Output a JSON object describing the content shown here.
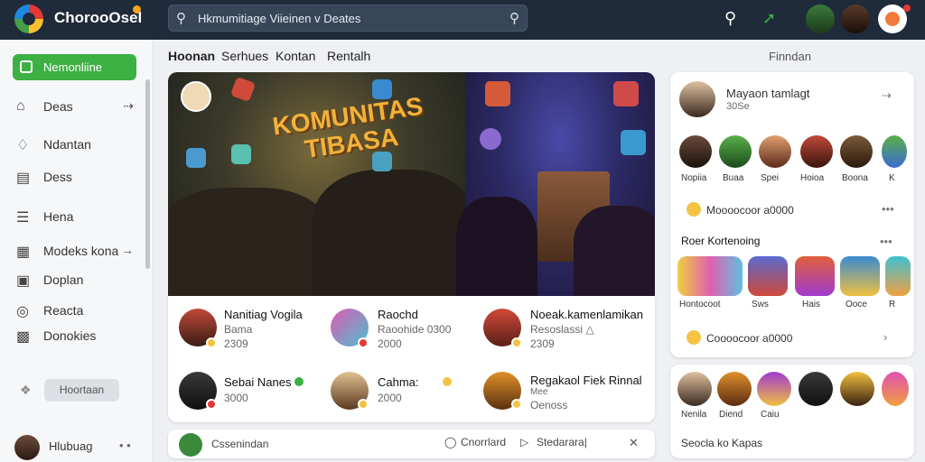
{
  "app": {
    "title": "ChorooOsel"
  },
  "search": {
    "query": "Hkmumitiage Viieinen v Deates"
  },
  "sidebar": {
    "active": "Nemonliine",
    "items": [
      {
        "label": "Deas",
        "icon": "home-icon",
        "arrow": "⇢"
      },
      {
        "label": "Ndantan",
        "icon": "bell-icon",
        "arrow": ""
      },
      {
        "label": "Dess",
        "icon": "window-icon",
        "arrow": ""
      },
      {
        "label": "Hena",
        "icon": "list-icon",
        "arrow": ""
      },
      {
        "label": "Modeks kona",
        "icon": "grid-icon",
        "arrow": "→"
      },
      {
        "label": "Doplan",
        "icon": "calendar-icon",
        "arrow": ""
      },
      {
        "label": "Reacta",
        "icon": "pin-icon",
        "arrow": ""
      },
      {
        "label": "Donokies",
        "icon": "chart-icon",
        "arrow": ""
      }
    ],
    "button": "Hoortaan",
    "user": {
      "name": "Hlubuag",
      "more": "• •"
    }
  },
  "tabs": [
    "Hoonan",
    "Serhues",
    "Kontan",
    "Rentalh"
  ],
  "filter_label": "Finndan",
  "hero": {
    "title": "KOMUNITAS TIBASA"
  },
  "cards": [
    {
      "name": "Nanitiag Vogila",
      "sub1": "Bama",
      "sub2": "2309"
    },
    {
      "name": "Raochd",
      "sub1": "Raoohide 0300",
      "sub2": "2000"
    },
    {
      "name": "Noeak.kamenlamikan",
      "sub1": "Resoslassi △",
      "sub2": "2309"
    },
    {
      "name": "Sebai Nanes",
      "sub1": "3000",
      "sub2": ""
    },
    {
      "name": "Cahma:",
      "sub1": "2000",
      "sub2": ""
    },
    {
      "name": "Regakaol Fiek Rinnal",
      "sub1": "Mee",
      "sub2": "Oenoss"
    }
  ],
  "bottom": {
    "text": "Cssenindan",
    "action1": "Cnorrlard",
    "action2": "Stedarara|",
    "close": "✕"
  },
  "profile": {
    "name": "Mayaon tamlagt",
    "sub": "30Se"
  },
  "row1_labels": [
    "Nopiia",
    "Buaa",
    "Spei",
    "Hoioa",
    "Boona",
    "K"
  ],
  "stat1": "Moooocoor a0000",
  "section": {
    "title": "Roer Kortenoing",
    "more": "•••"
  },
  "row2_labels": [
    "Hontocoot",
    "Sws",
    "Hais",
    "Ooce",
    "R"
  ],
  "stat2": "Coooocoor a0000",
  "row3_labels": [
    "Nenila",
    "Diend",
    "Caiu"
  ],
  "footer": "Seocla ko Kapas",
  "colors": {
    "topbar": "#1f2a3a",
    "accent": "#3cb043",
    "coin": "#f5c242"
  }
}
